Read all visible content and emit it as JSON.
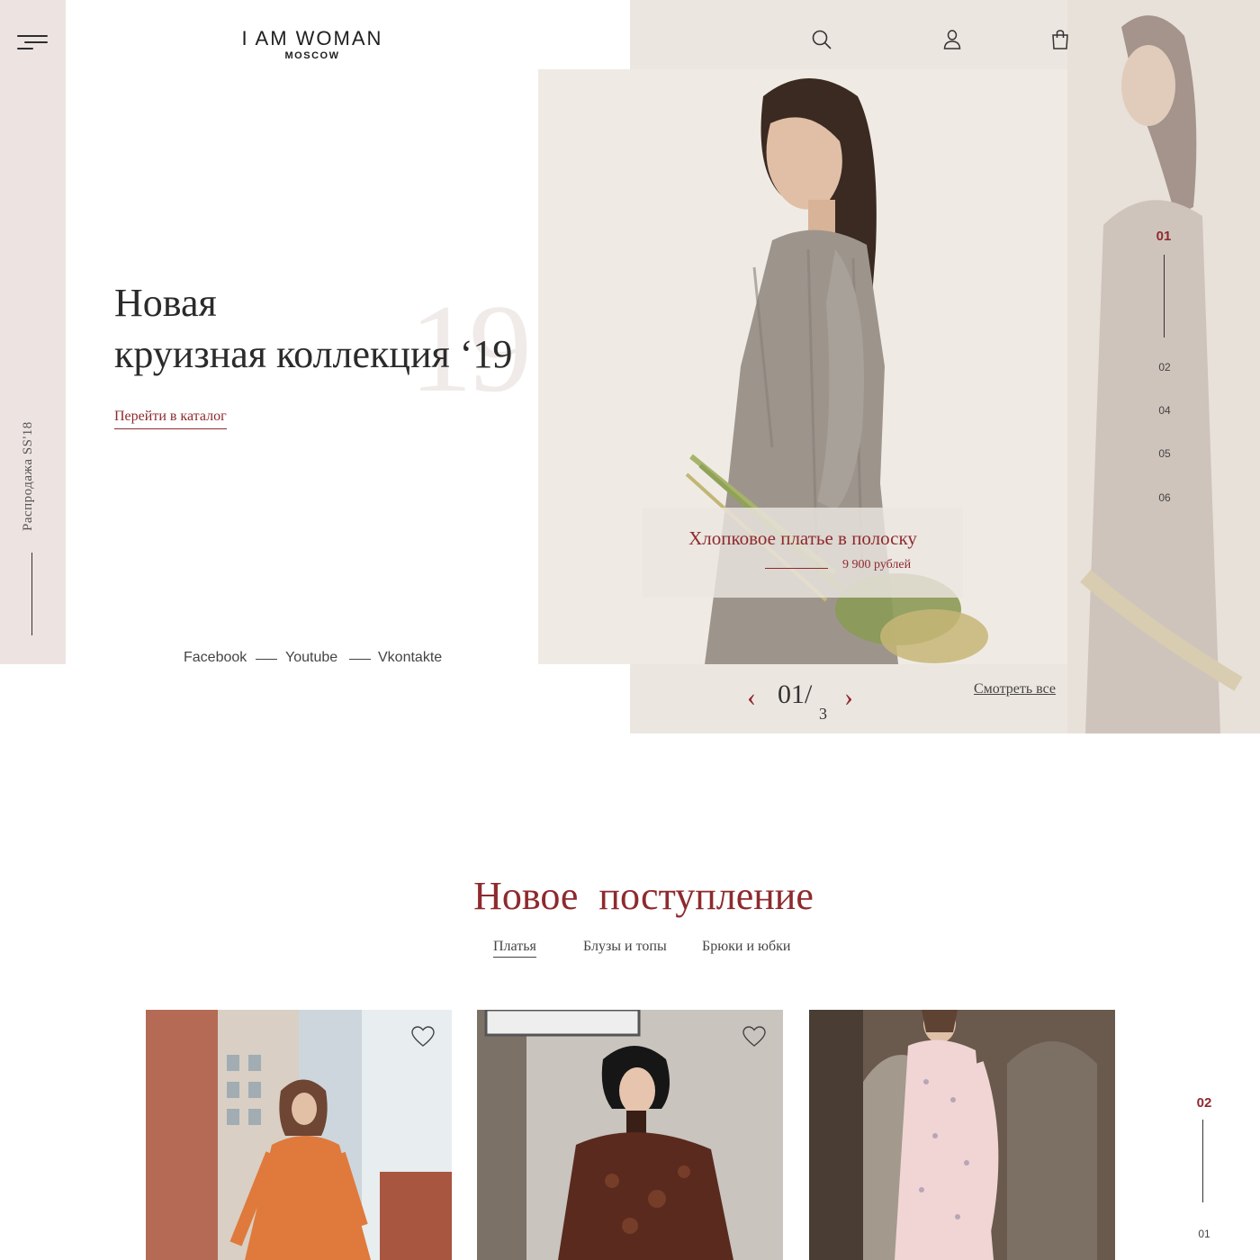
{
  "brand": {
    "name": "I AM WOMAN",
    "city": "MOSCOW"
  },
  "sidebar": {
    "sale_label": "Распродажа  SS'18"
  },
  "header": {
    "icons": [
      "search-icon",
      "user-icon",
      "bag-icon"
    ]
  },
  "hero": {
    "title_line1": "Новая",
    "title_line2": "круизная коллекция ‘19",
    "bg_number": "19",
    "catalog_link": "Перейти в каталог",
    "product_name": "Хлопковое платье в полоску",
    "product_price": "9 900 рублей"
  },
  "social": {
    "facebook": "Facebook",
    "youtube": "Youtube",
    "vkontakte": "Vkontakte"
  },
  "slider": {
    "active": "01",
    "numbers": [
      "02",
      "04",
      "05",
      "06"
    ],
    "current": "01/",
    "total": "3",
    "prev_arrow": "‹",
    "next_arrow": "›",
    "view_all": "Смотреть все"
  },
  "new_arrivals": {
    "title": "Новое поступление",
    "tabs": [
      "Платья",
      "Блузы и топы",
      "Брюки и юбки"
    ],
    "active_tab": 0,
    "pager_active": "02",
    "pager_other": "01"
  },
  "colors": {
    "accent": "#8e2a2e",
    "sidebar_bg": "#ede4e2",
    "hero_bg": "#ece6e0"
  }
}
